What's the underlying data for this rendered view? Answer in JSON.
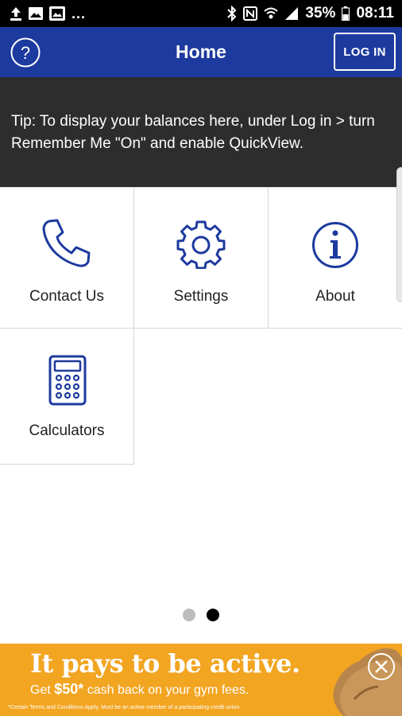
{
  "status_bar": {
    "battery": "35%",
    "time": "08:11",
    "overflow": "..."
  },
  "header": {
    "title": "Home",
    "login_label": "LOG IN"
  },
  "tip": {
    "text": "Tip: To display your balances here, under Log in > turn Remember Me \"On\" and enable QuickView."
  },
  "tiles": [
    {
      "label": "Contact Us",
      "icon": "phone-icon"
    },
    {
      "label": "Settings",
      "icon": "gear-icon"
    },
    {
      "label": "About",
      "icon": "info-icon"
    },
    {
      "label": "Calculators",
      "icon": "calculator-icon"
    }
  ],
  "pagination": {
    "pages": 2,
    "current": 2
  },
  "ad": {
    "headline": "It pays to be active.",
    "sub_prefix": "Get ",
    "sub_amount": "$50*",
    "sub_suffix": " cash back on your gym fees.",
    "fine_print": "*Certain Terms and Conditions Apply. Must be an active member of a participating credit union."
  },
  "colors": {
    "header_bg": "#1d3a9e",
    "icon_blue": "#1d3a9e",
    "tip_bg": "#2d2d2d",
    "ad_bg": "#f2a521"
  }
}
